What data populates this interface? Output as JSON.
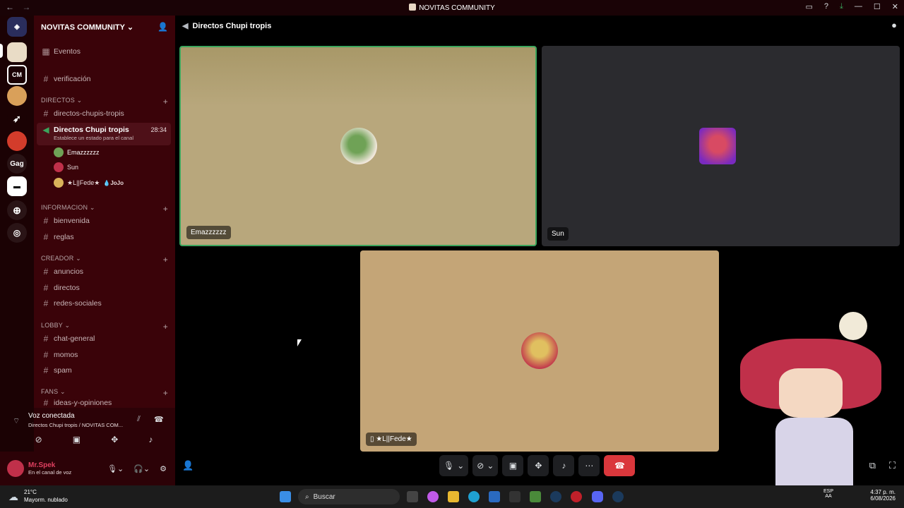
{
  "window": {
    "title": "NOVITAS COMMUNITY",
    "back": "←",
    "forward": "→"
  },
  "guild": {
    "name": "NOVITAS COMMUNITY"
  },
  "channels": {
    "events": "Eventos",
    "verify": "verificación",
    "cat_directos": "DIRECTOS",
    "directos_text": "directos-chupis-tropis",
    "voice_name": "Directos Chupi tropis",
    "voice_timer": "28:34",
    "voice_status": "Establece un estado para el canal",
    "members": [
      {
        "name": "Emazzzzzz"
      },
      {
        "name": "Sun"
      },
      {
        "name": "★L||Fede★",
        "badge": "JoJo"
      }
    ],
    "cat_info": "INFORMACION",
    "bienvenida": "bienvenida",
    "reglas": "reglas",
    "cat_creador": "CREADOR",
    "anuncios": "anuncios",
    "directos": "directos",
    "redes": "redes-sociales",
    "cat_lobby": "LOBBY",
    "chat": "chat-general",
    "momos": "momos",
    "spam": "spam",
    "cat_fans": "FANS",
    "ideas": "ideas-y-opiniones"
  },
  "voice": {
    "connected": "Voz conectada",
    "location": "Directos Chupi tropis / NOVITAS COM..."
  },
  "user": {
    "name": "Mr.Spek",
    "status": "En el canal de voz"
  },
  "header": {
    "channel": "Directos Chupi tropis"
  },
  "tiles": [
    {
      "name": "Emazzzzzz",
      "color": "#b8a77c"
    },
    {
      "name": "Sun",
      "color": "#2b2b2f"
    },
    {
      "name": "★L||Fede★",
      "color": "#c4a577"
    }
  ],
  "taskbar": {
    "weather_temp": "21°C",
    "weather_desc": "Mayorm. nublado",
    "search": "Buscar",
    "lang1": "ESP",
    "lang2": "AA",
    "time": "4:37 p. m.",
    "date": "6/08/2026"
  },
  "colors": {
    "accent": "#da373c",
    "sidebar": "#3a0309",
    "servers": "#1b0204"
  },
  "serverlabel": "Gag"
}
